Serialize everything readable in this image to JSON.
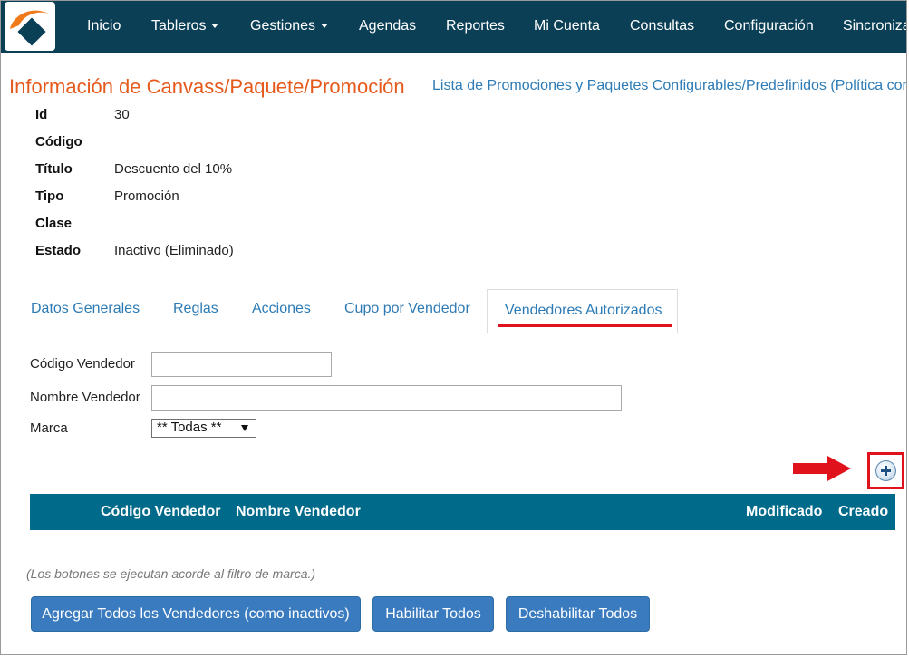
{
  "nav": {
    "items": [
      {
        "label": "Inicio",
        "dropdown": false
      },
      {
        "label": "Tableros",
        "dropdown": true
      },
      {
        "label": "Gestiones",
        "dropdown": true
      },
      {
        "label": "Agendas",
        "dropdown": false
      },
      {
        "label": "Reportes",
        "dropdown": false
      },
      {
        "label": "Mi Cuenta",
        "dropdown": false
      },
      {
        "label": "Consultas",
        "dropdown": false
      },
      {
        "label": "Configuración",
        "dropdown": false
      },
      {
        "label": "Sincroniza",
        "dropdown": false
      }
    ],
    "background": "#0b3f56"
  },
  "page": {
    "title": "Información de Canvass/Paquete/Promoción",
    "header_link": "Lista de Promociones y Paquetes Configurables/Predefinidos (Política com"
  },
  "info": {
    "rows": [
      {
        "label": "Id",
        "value": "30"
      },
      {
        "label": "Código",
        "value": ""
      },
      {
        "label": "Título",
        "value": "Descuento del 10%"
      },
      {
        "label": "Tipo",
        "value": "Promoción"
      },
      {
        "label": "Clase",
        "value": ""
      },
      {
        "label": "Estado",
        "value": "Inactivo (Eliminado)"
      }
    ]
  },
  "tabs": {
    "items": [
      "Datos Generales",
      "Reglas",
      "Acciones",
      "Cupo por Vendedor"
    ],
    "active": "Vendedores Autorizados"
  },
  "filters": {
    "codigo_label": "Código Vendedor",
    "codigo_value": "",
    "nombre_label": "Nombre Vendedor",
    "nombre_value": "",
    "marca_label": "Marca",
    "marca_selected": "** Todas **"
  },
  "table": {
    "columns": [
      "Código Vendedor",
      "Nombre Vendedor",
      "Modificado",
      "Creado"
    ],
    "header_color": "#006a8a"
  },
  "note": "(Los botones se ejecutan acorde al filtro de marca.)",
  "buttons": {
    "add_all": "Agregar Todos los Vendedores (como inactivos)",
    "enable_all": "Habilitar Todos",
    "disable_all": "Deshabilitar Todos"
  },
  "colors": {
    "title": "#e55a1c",
    "link": "#2d7bb6",
    "highlight": "#e0121b",
    "button": "#3a7bbf"
  },
  "icons": {
    "add": "plus-circle-icon",
    "annotation": "red-arrow-icon"
  }
}
